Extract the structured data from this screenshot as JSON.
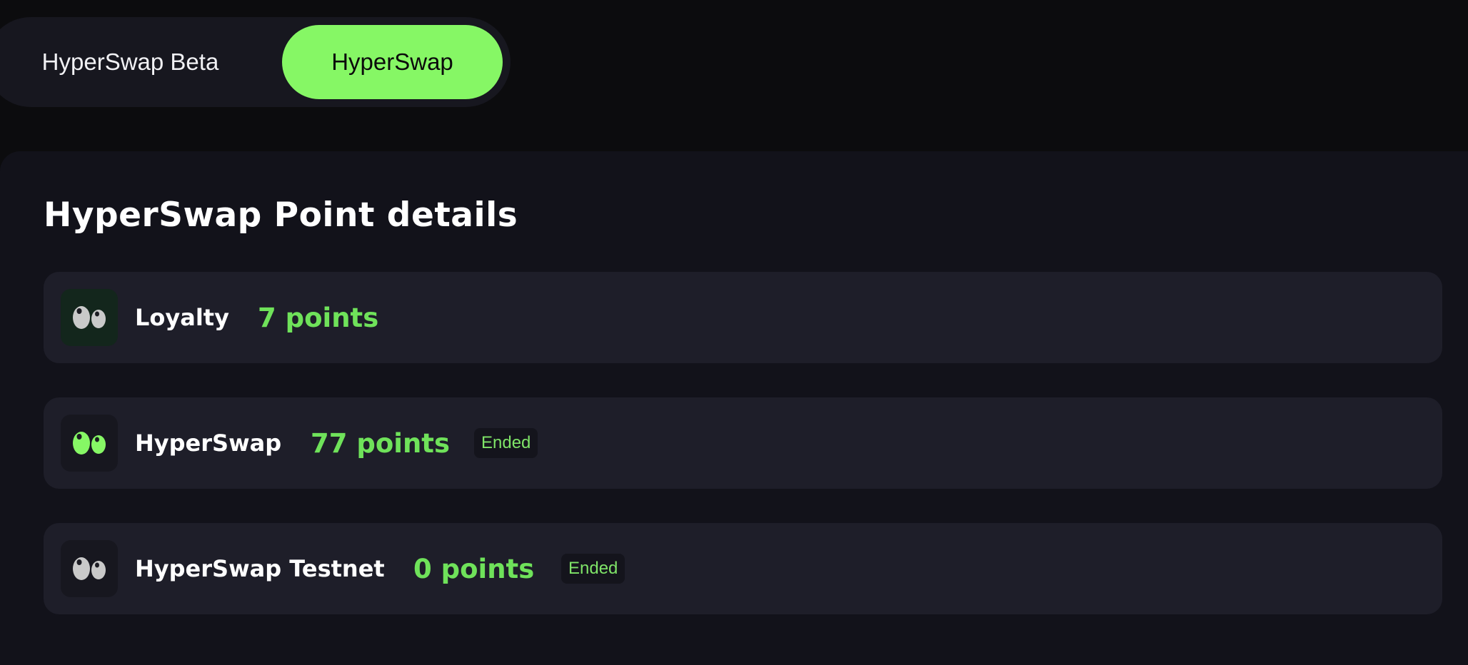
{
  "tabs": [
    {
      "label": "HyperSwap Beta",
      "active": false
    },
    {
      "label": "HyperSwap",
      "active": true
    }
  ],
  "panel": {
    "title": "HyperSwap Point details",
    "rows": [
      {
        "name": "Loyalty",
        "points": "7 points",
        "badge": null,
        "icon": "eyes-icon",
        "icon_color": "#c9c9c9",
        "icon_bg": "#13261c"
      },
      {
        "name": "HyperSwap",
        "points": "77 points",
        "badge": "Ended",
        "icon": "eyes-icon",
        "icon_color": "#86f765",
        "icon_bg": "#17171f"
      },
      {
        "name": "HyperSwap Testnet",
        "points": "0 points",
        "badge": "Ended",
        "icon": "eyes-icon",
        "icon_color": "#c9c9c9",
        "icon_bg": "#17171f"
      }
    ]
  },
  "colors": {
    "accent": "#86f765",
    "points_text": "#6fe25a",
    "background": "#0c0c0e",
    "panel": "#12121a",
    "row": "#1e1e29"
  }
}
